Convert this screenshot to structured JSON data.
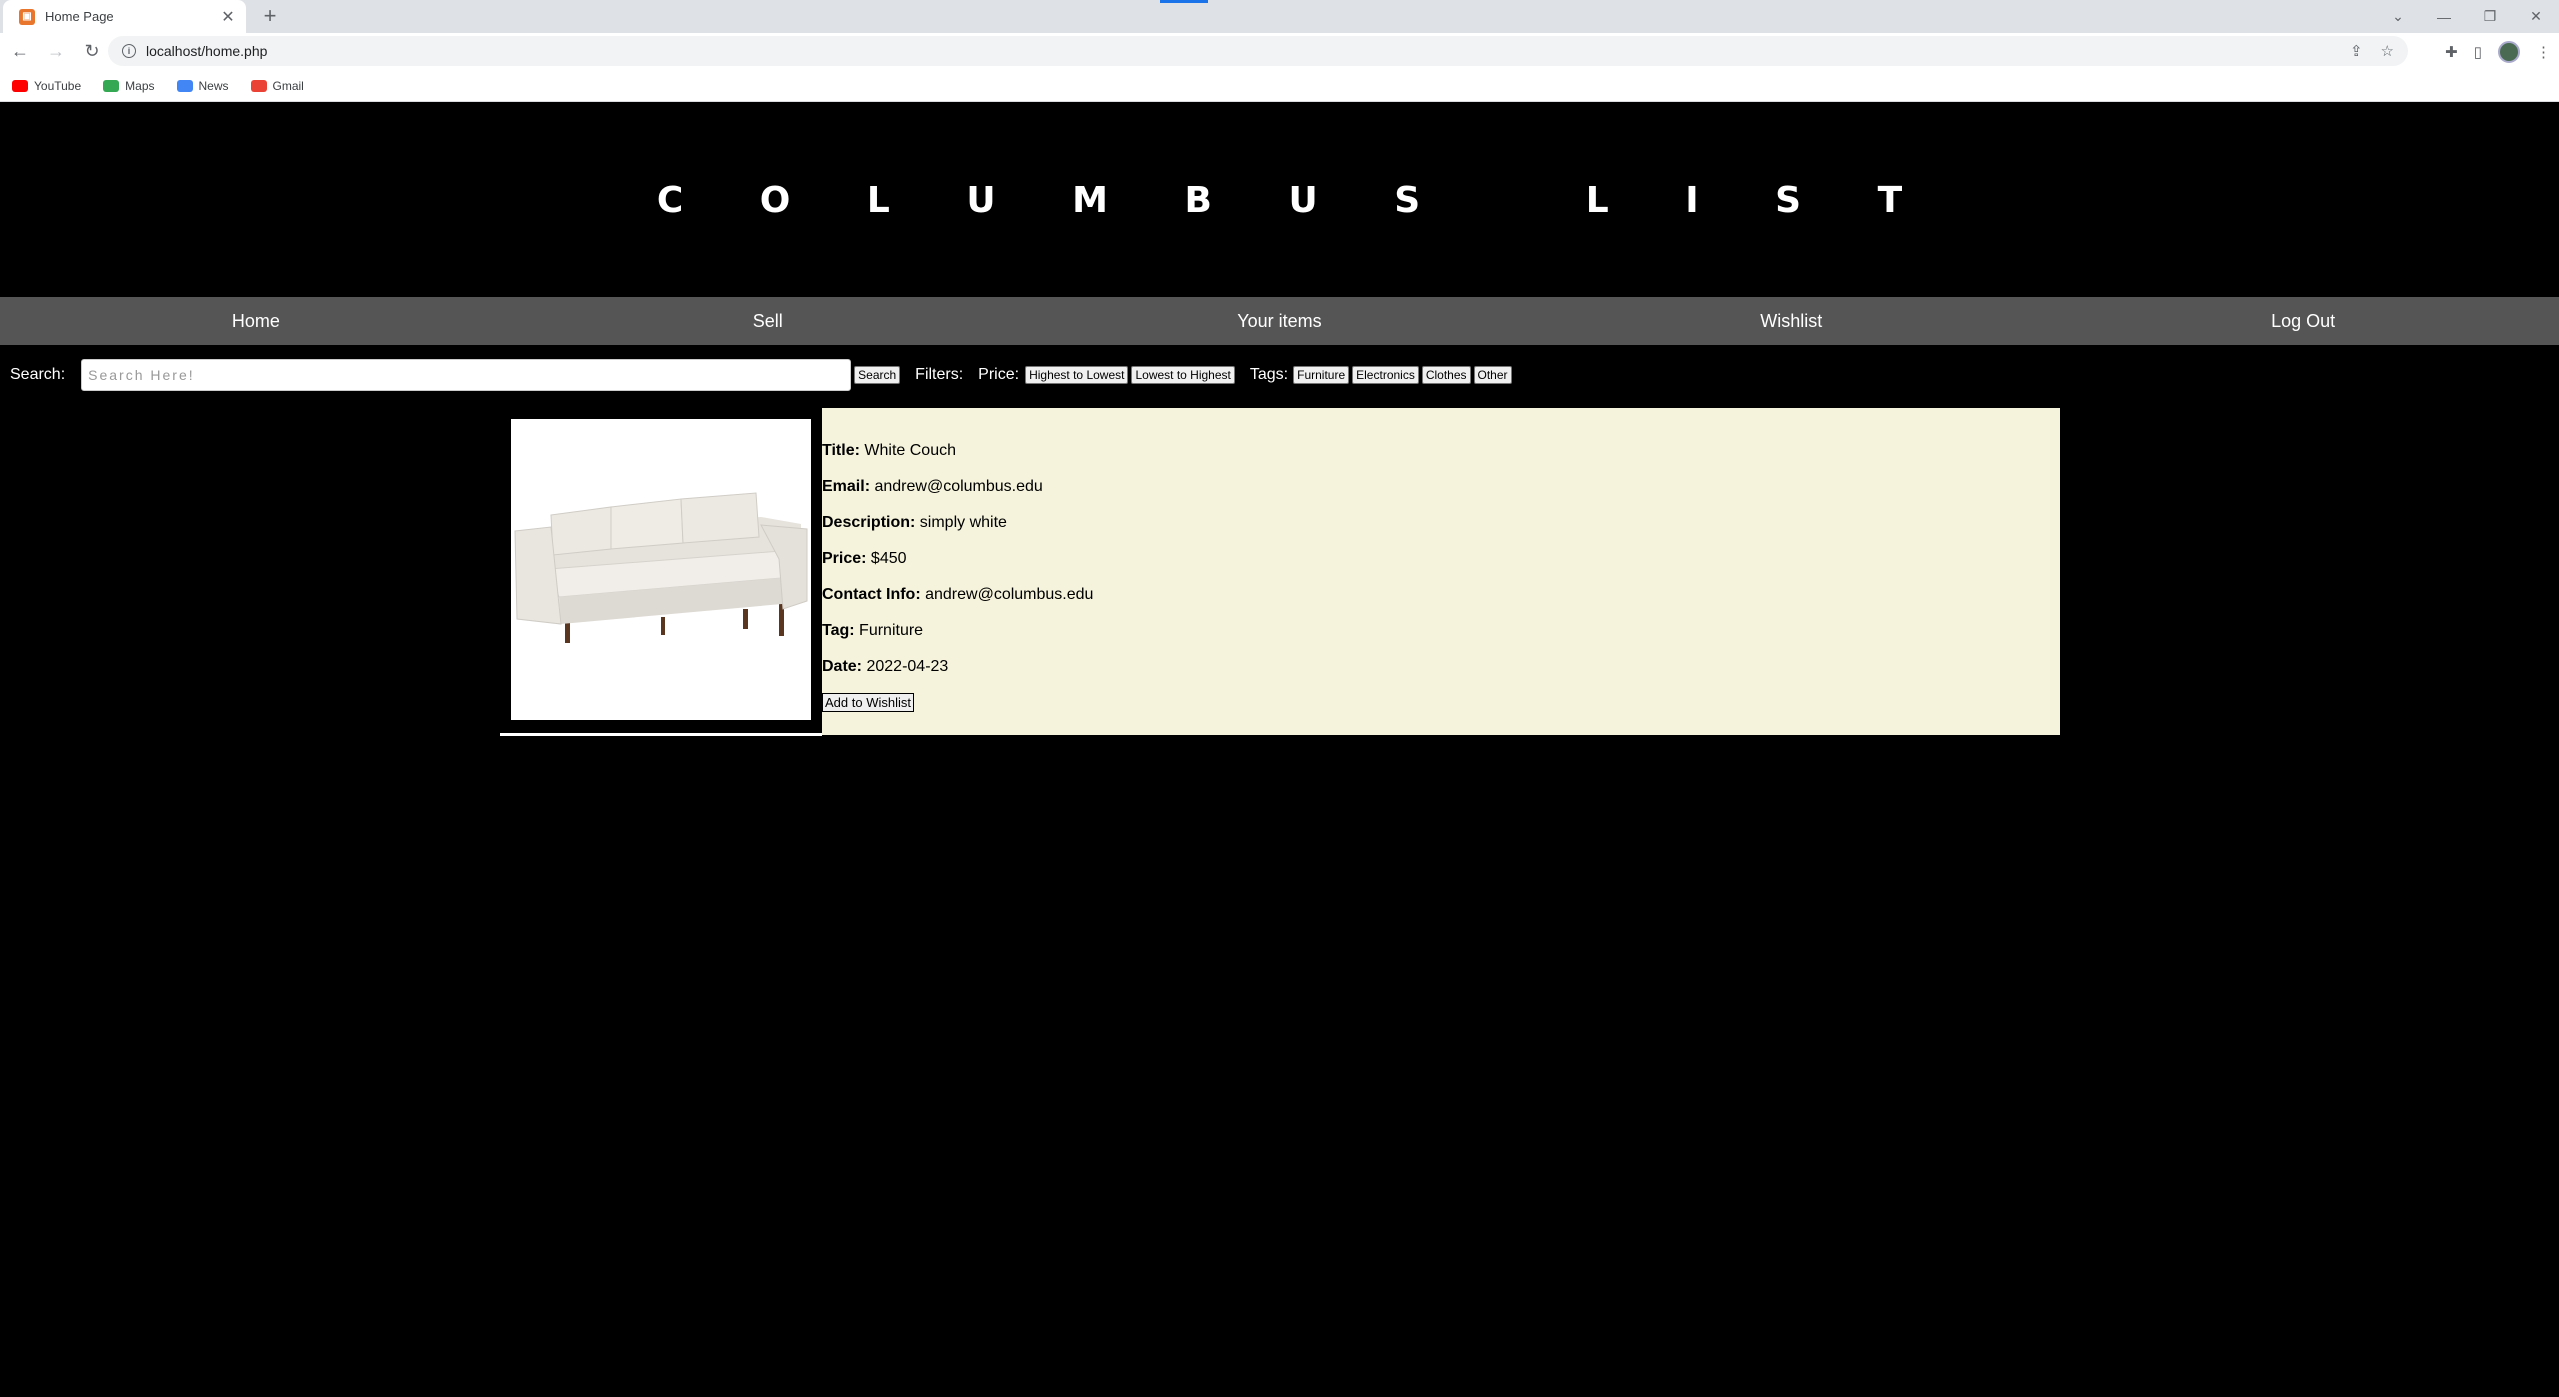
{
  "browser": {
    "tab_title": "Home Page",
    "url": "localhost/home.php",
    "bookmarks": [
      {
        "label": "YouTube",
        "color": "#ff0000"
      },
      {
        "label": "Maps",
        "color": "#34a853"
      },
      {
        "label": "News",
        "color": "#4285f4"
      },
      {
        "label": "Gmail",
        "color": "#ea4335"
      }
    ]
  },
  "site": {
    "title": "C O L U M B U S   L I S T"
  },
  "nav": {
    "items": [
      "Home",
      "Sell",
      "Your items",
      "Wishlist",
      "Log Out"
    ]
  },
  "search": {
    "label": "Search:",
    "placeholder": "Search Here!",
    "button": "Search",
    "filters_label": "Filters:",
    "price_label": "Price:",
    "price_options": [
      "Highest to Lowest",
      "Lowest to Highest"
    ],
    "tags_label": "Tags:",
    "tag_options": [
      "Furniture",
      "Electronics",
      "Clothes",
      "Other"
    ]
  },
  "listing": {
    "fields": [
      {
        "label": "Title:",
        "value": "White Couch"
      },
      {
        "label": "Email:",
        "value": "andrew@columbus.edu"
      },
      {
        "label": "Description:",
        "value": "simply white"
      },
      {
        "label": "Price:",
        "value": "$450"
      },
      {
        "label": "Contact Info:",
        "value": "andrew@columbus.edu"
      },
      {
        "label": "Tag:",
        "value": "Furniture"
      },
      {
        "label": "Date:",
        "value": "2022-04-23"
      }
    ],
    "wishlist_button": "Add to Wishlist"
  },
  "colors": {
    "page_bg": "#000000",
    "navbar_bg": "#555555",
    "details_bg": "#f5f3dc"
  }
}
